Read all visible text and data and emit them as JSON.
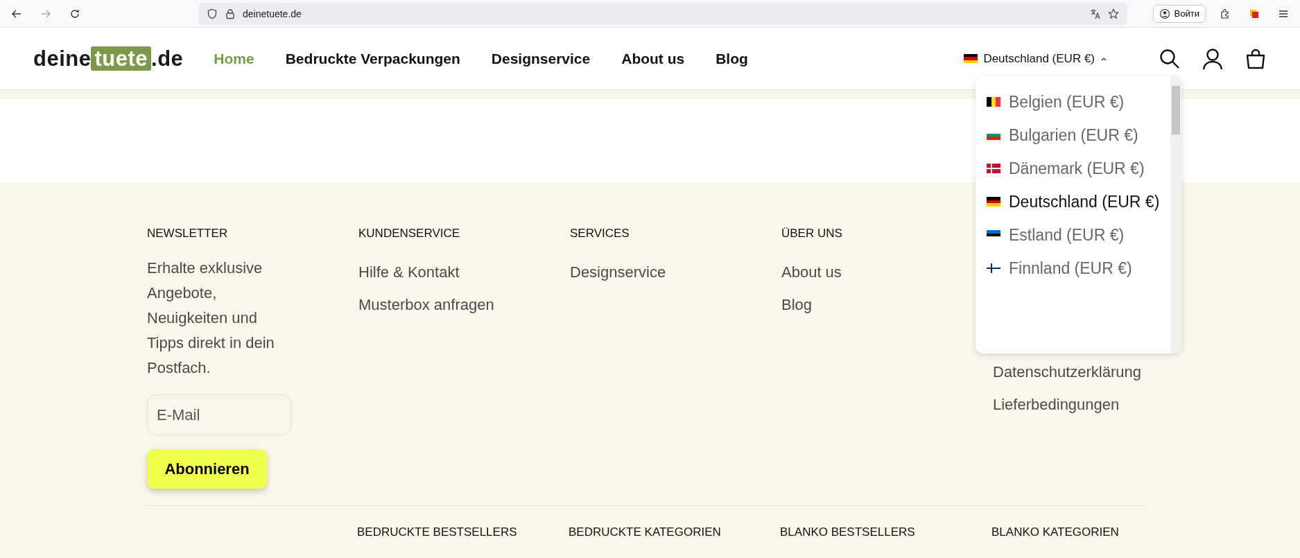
{
  "browser": {
    "url": "deinetuete.de",
    "account_button": "Войти"
  },
  "header": {
    "logo": {
      "before": "deine",
      "boxed": "tuete",
      "after": ".de"
    },
    "nav": [
      {
        "label": "Home",
        "selected": true
      },
      {
        "label": "Bedruckte Verpackungen",
        "selected": false
      },
      {
        "label": "Designservice",
        "selected": false
      },
      {
        "label": "About us",
        "selected": false
      },
      {
        "label": "Blog",
        "selected": false
      }
    ],
    "country_selector": {
      "label": "Deutschland (EUR €)",
      "expanded": true
    }
  },
  "country_dropdown": [
    {
      "label": "Belgien (EUR €)",
      "selected": false
    },
    {
      "label": "Bulgarien (EUR €)",
      "selected": false
    },
    {
      "label": "Dänemark (EUR €)",
      "selected": false
    },
    {
      "label": "Deutschland (EUR €)",
      "selected": true
    },
    {
      "label": "Estland (EUR €)",
      "selected": false
    },
    {
      "label": "Finnland (EUR €)",
      "selected": false
    }
  ],
  "footer": {
    "newsletter": {
      "heading": "NEWSLETTER",
      "text": "Erhalte exklusive Angebote, Neuigkeiten und Tipps direkt in dein Postfach.",
      "email_placeholder": "E-Mail",
      "button": "Abonnieren"
    },
    "columns": [
      {
        "heading": "KUNDENSERVICE",
        "links": [
          "Hilfe & Kontakt",
          "Musterbox anfragen"
        ]
      },
      {
        "heading": "SERVICES",
        "links": [
          "Designservice"
        ]
      },
      {
        "heading": "ÜBER UNS",
        "links": [
          "About us",
          "Blog"
        ]
      }
    ],
    "general_links": [
      "Datenschutzerklärung",
      "Lieferbedingungen"
    ],
    "bottom_headings": [
      "BEDRUCKTE BESTSELLERS",
      "BEDRUCKTE KATEGORIEN",
      "BLANKO BESTSELLERS",
      "BLANKO KATEGORIEN"
    ]
  }
}
